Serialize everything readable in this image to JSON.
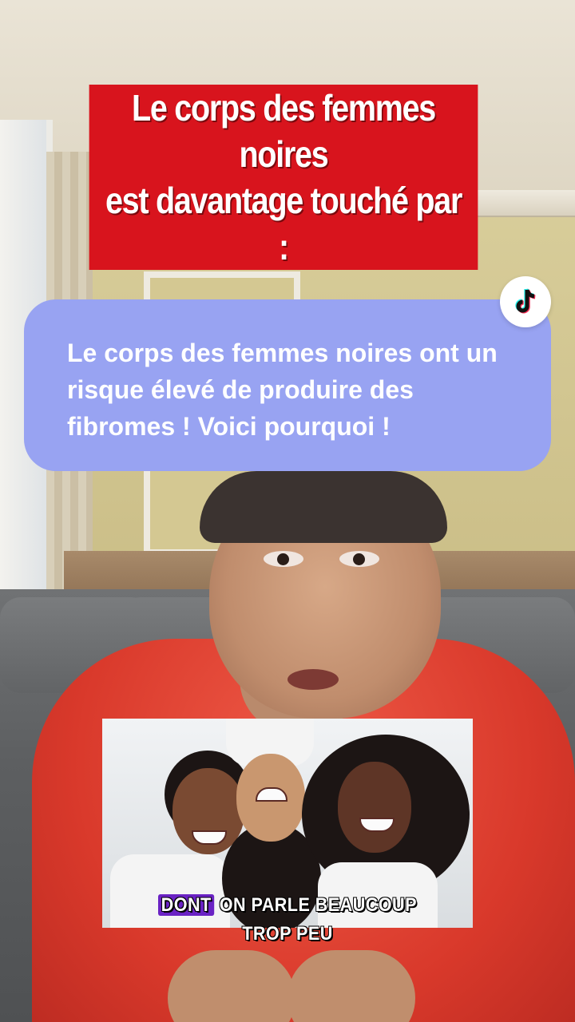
{
  "headline": {
    "line1": "Le corps des femmes noires",
    "line2": "est davantage touché par :"
  },
  "bubble": {
    "text": "Le corps des femmes noires ont un risque élevé de produire des fibromes ! Voici pourquoi !"
  },
  "badge": {
    "icon": "tiktok-icon"
  },
  "caption": {
    "highlight": "DONT",
    "rest": " ON PARLE BEAUCOUP",
    "line2": "TROP PEU"
  },
  "colors": {
    "headline_bg": "#d8141d",
    "bubble_bg": "#98a3f2",
    "caption_highlight": "#6a22c4"
  }
}
